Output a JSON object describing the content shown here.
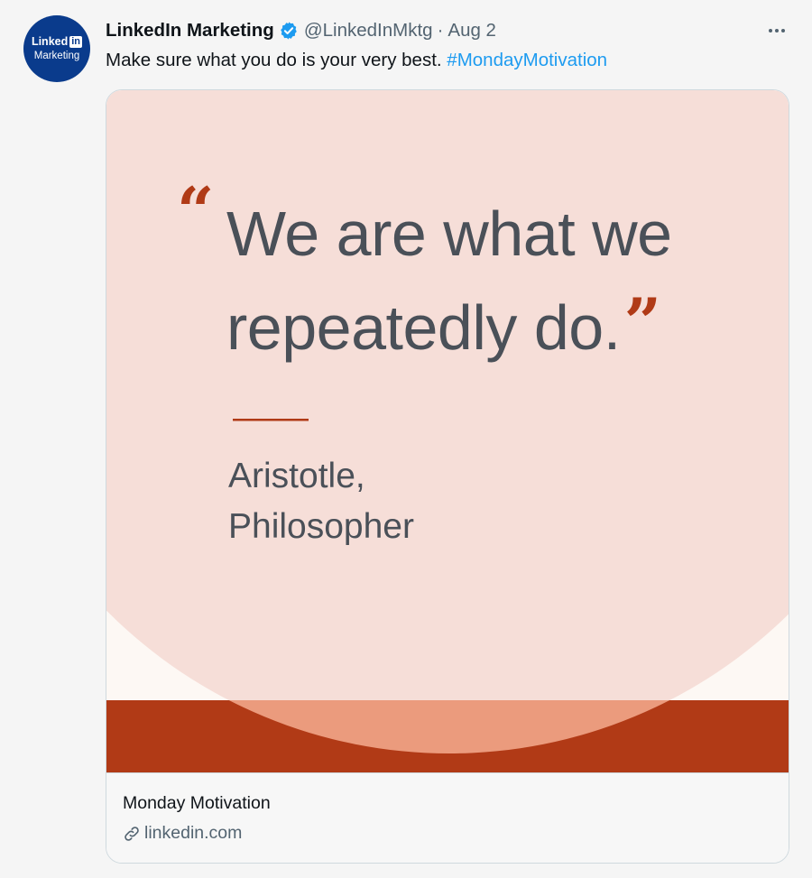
{
  "author": {
    "avatar_line1": "Linked",
    "avatar_in": "in",
    "avatar_line2": "Marketing",
    "name": "LinkedIn Marketing",
    "handle": "@LinkedInMktg",
    "separator": "·",
    "date": "Aug 2"
  },
  "tweet": {
    "text": "Make sure what you do is your very best.",
    "hashtag": "#MondayMotivation"
  },
  "card": {
    "quote_line1": "We are what we",
    "quote_line2": "repeatedly do.",
    "open_quote": "“",
    "close_quote": "”",
    "author_line1": "Aristotle,",
    "author_line2": "Philosopher",
    "title": "Monday Motivation",
    "domain": "linkedin.com"
  },
  "colors": {
    "verified": "#1d9bf0",
    "hashtag": "#1d9bf0",
    "card_pink": "#f6ded8",
    "quote_text": "#4a5058",
    "accent": "#b03a16",
    "band_light": "#eb9b7d",
    "band_dark": "#b13a16",
    "avatar_bg": "#0a3b8c"
  },
  "icons": {
    "verified": "verified-badge-icon",
    "more": "more-dots-icon",
    "link": "link-icon"
  }
}
